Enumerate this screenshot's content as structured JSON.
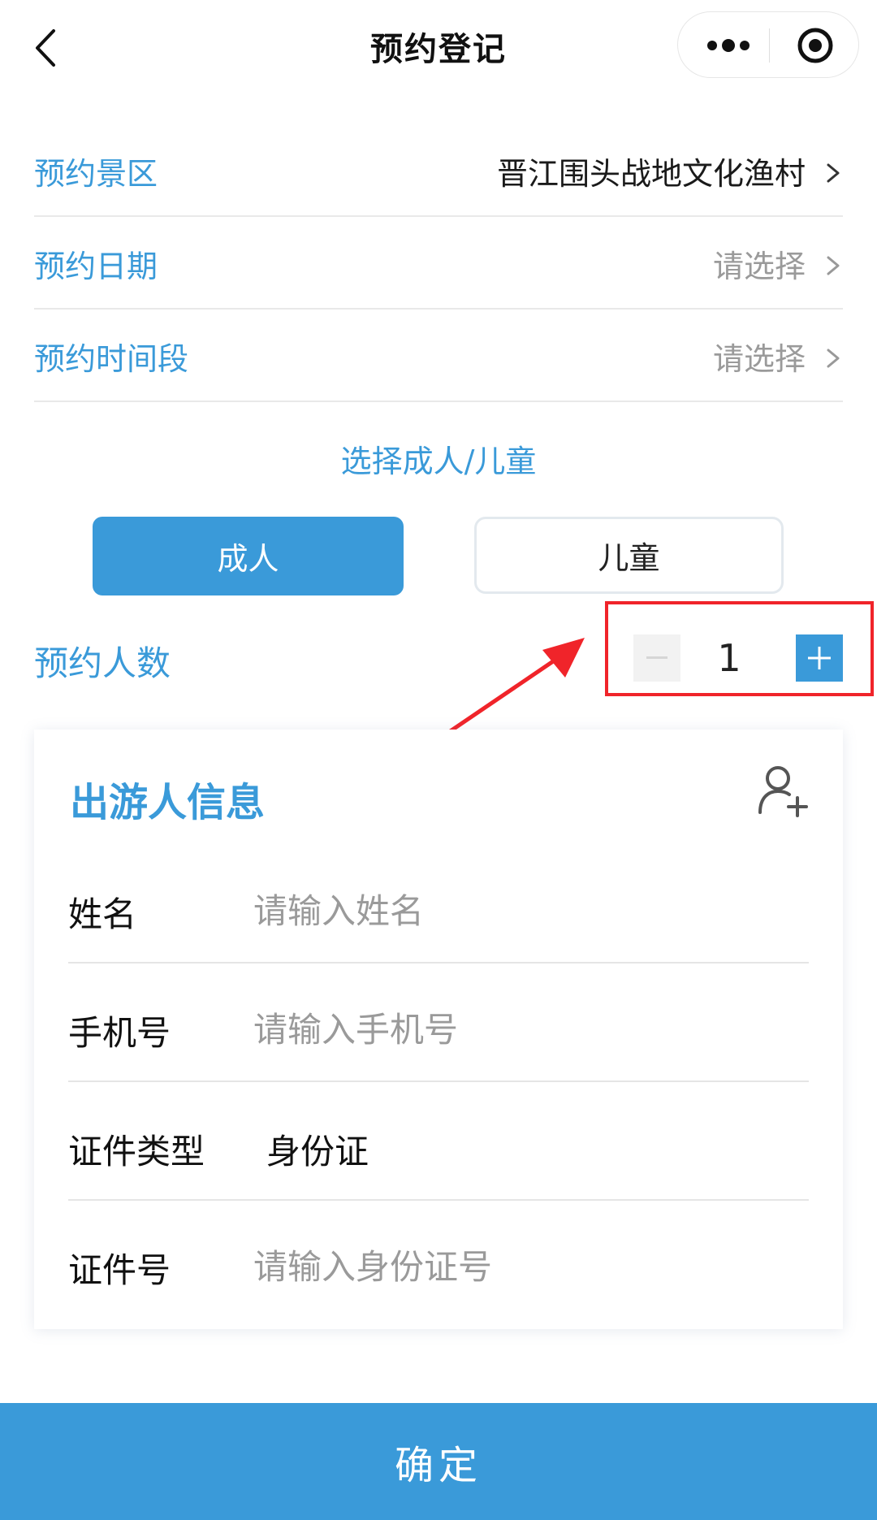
{
  "nav": {
    "title": "预约登记",
    "back_icon": "chevron-left-icon",
    "more_icon": "more-dots-icon",
    "close_icon": "target-icon"
  },
  "form": {
    "rows": [
      {
        "label": "预约景区",
        "value": "晋江围头战地文化渔村",
        "is_placeholder": false
      },
      {
        "label": "预约日期",
        "value": "请选择",
        "is_placeholder": true
      },
      {
        "label": "预约时间段",
        "value": "请选择",
        "is_placeholder": true
      }
    ]
  },
  "type_select": {
    "title": "选择成人/儿童",
    "adult": "成人",
    "child": "儿童",
    "selected": "adult"
  },
  "count": {
    "label": "预约人数",
    "value": "1",
    "minus": "−",
    "plus": "+"
  },
  "traveler": {
    "title": "出游人信息",
    "fields": {
      "name_label": "姓名",
      "name_placeholder": "请输入姓名",
      "phone_label": "手机号",
      "phone_placeholder": "请输入手机号",
      "idtype_label": "证件类型",
      "idtype_value": "身份证",
      "idno_label": "证件号",
      "idno_placeholder": "请输入身份证号"
    }
  },
  "confirm": "确定",
  "colors": {
    "accent": "#3a9ad9",
    "annotation": "#f0242a"
  }
}
